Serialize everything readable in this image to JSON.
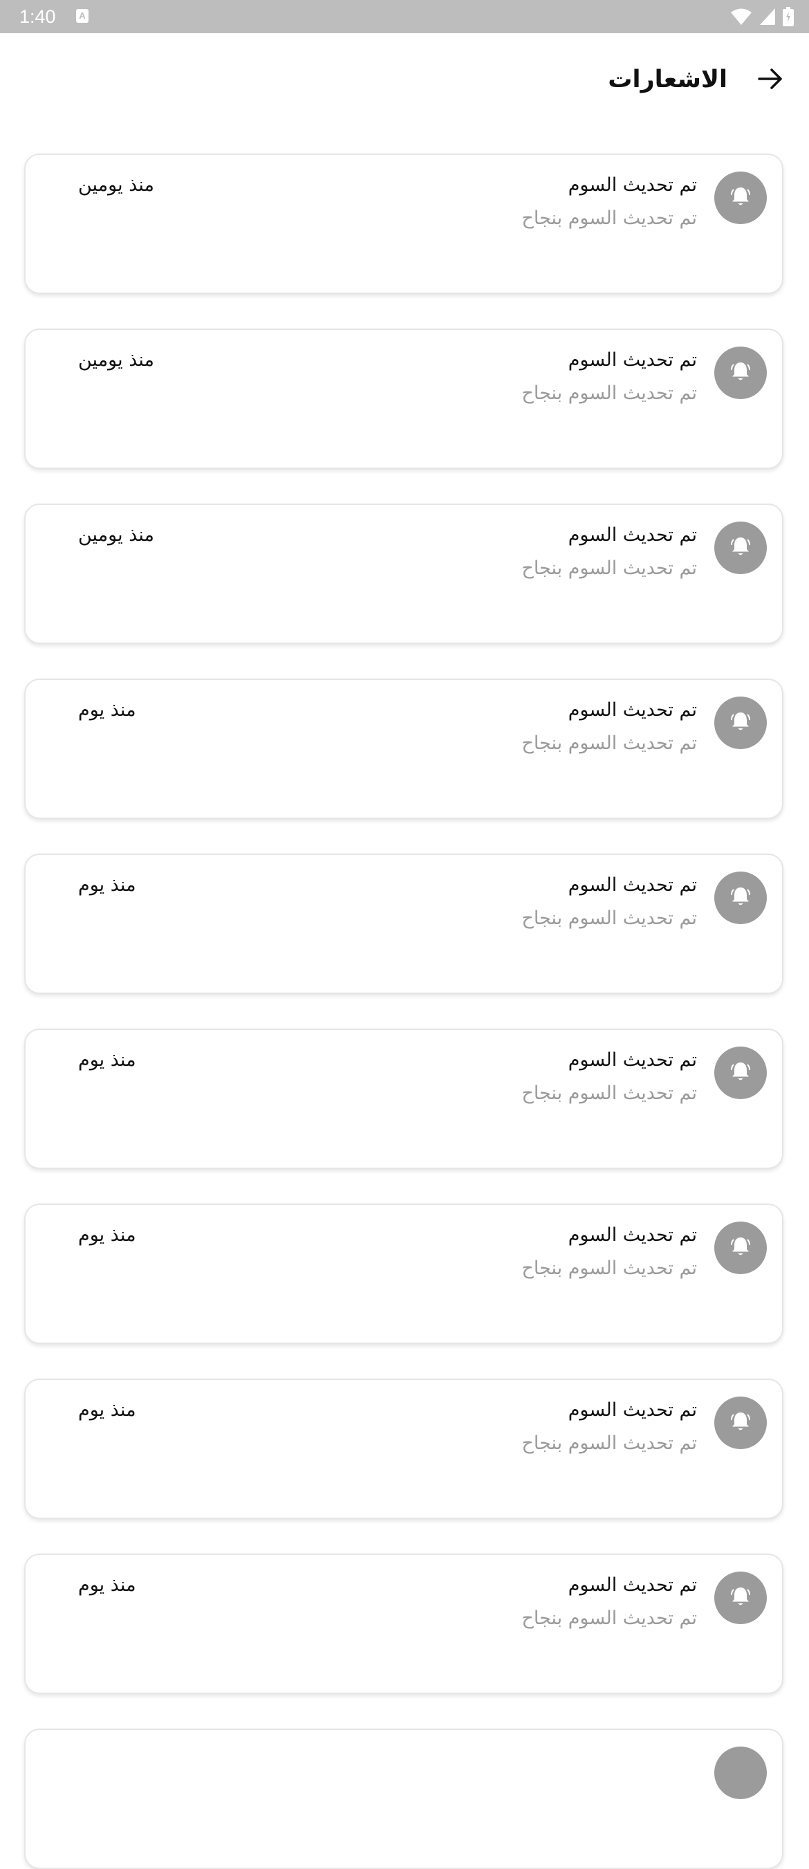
{
  "status_bar": {
    "time": "1:40",
    "notification_icon": "a-icon",
    "icons": [
      "wifi-icon",
      "signal-icon",
      "battery-icon"
    ],
    "background": "#bdbdbd"
  },
  "header": {
    "title": "الاشعارات",
    "back_icon": "arrow-right-icon"
  },
  "notifications": [
    {
      "title": "تم تحديث السوم",
      "body": "تم تحديث السوم بنجاح",
      "time": "منذ يومين",
      "icon": "bell-icon"
    },
    {
      "title": "تم تحديث السوم",
      "body": "تم تحديث السوم بنجاح",
      "time": "منذ يومين",
      "icon": "bell-icon"
    },
    {
      "title": "تم تحديث السوم",
      "body": "تم تحديث السوم بنجاح",
      "time": "منذ يومين",
      "icon": "bell-icon"
    },
    {
      "title": "تم تحديث السوم",
      "body": "تم تحديث السوم بنجاح",
      "time": "منذ يوم",
      "icon": "bell-icon"
    },
    {
      "title": "تم تحديث السوم",
      "body": "تم تحديث السوم بنجاح",
      "time": "منذ يوم",
      "icon": "bell-icon"
    },
    {
      "title": "تم تحديث السوم",
      "body": "تم تحديث السوم بنجاح",
      "time": "منذ يوم",
      "icon": "bell-icon"
    },
    {
      "title": "تم تحديث السوم",
      "body": "تم تحديث السوم بنجاح",
      "time": "منذ يوم",
      "icon": "bell-icon"
    },
    {
      "title": "تم تحديث السوم",
      "body": "تم تحديث السوم بنجاح",
      "time": "منذ يوم",
      "icon": "bell-icon"
    },
    {
      "title": "تم تحديث السوم",
      "body": "تم تحديث السوم بنجاح",
      "time": "منذ يوم",
      "icon": "bell-icon"
    }
  ],
  "colors": {
    "avatar": "#9b9b9b",
    "body_text": "#9a9a9a",
    "title_text": "#111111",
    "card_border": "#e6e6e6"
  }
}
